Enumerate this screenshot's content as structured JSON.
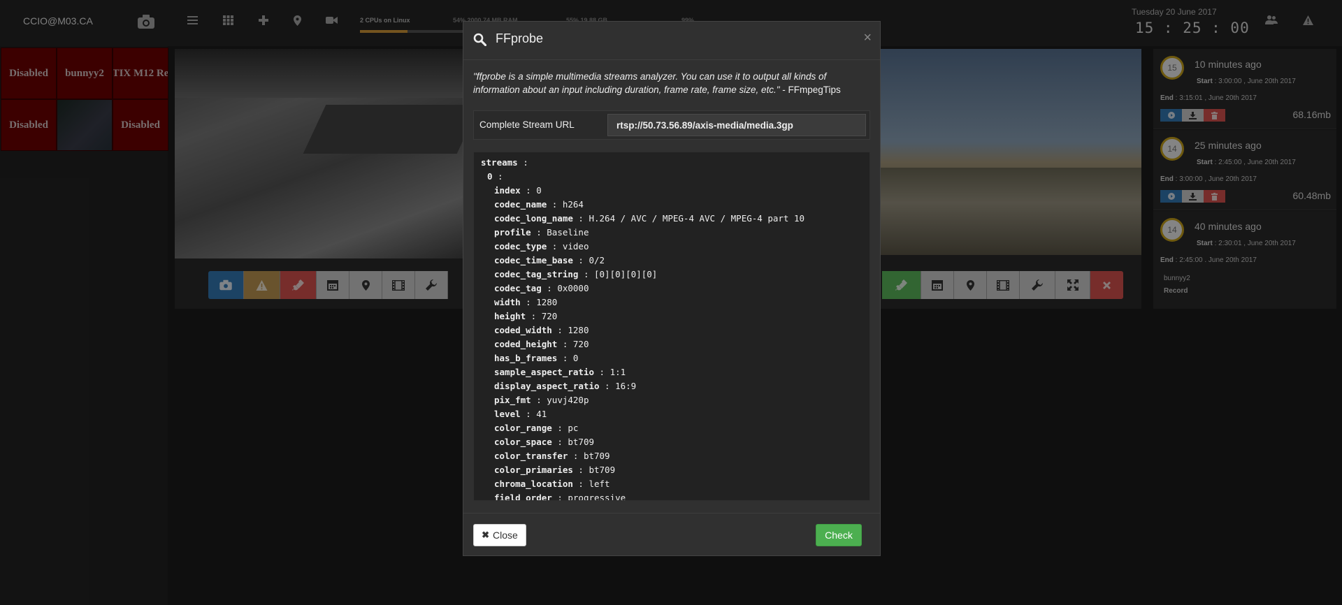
{
  "topbar": {
    "brand": "CCIO@M03.CA",
    "nav_icons": [
      "menu-icon",
      "grid-icon",
      "plus-icon",
      "map-marker-icon",
      "video-camera-icon"
    ],
    "cpu_label": "2 CPUs on Linux",
    "cpu_progress": 0.45,
    "ram_label": "54%  2000.74 MB RAM",
    "disk_label": "55%  19.88 GB",
    "net_label": "99%",
    "date": "Tuesday 20 June 2017",
    "time": "15 : 25 : 00",
    "right_icons": [
      "users-icon",
      "warning-icon"
    ]
  },
  "monitors": [
    {
      "label": "Disabled"
    },
    {
      "label": "bunnyy2"
    },
    {
      "label": "TIX M12 Re"
    },
    {
      "label": "Disabled"
    },
    {
      "label": ""
    },
    {
      "label": "Disabled"
    }
  ],
  "recordings": [
    {
      "count": "15",
      "ago": "10 minutes ago",
      "start_label": "Start",
      "start": ": 3:00:00 , June 20th 2017",
      "end_label": "End",
      "end": ": 3:15:01 , June 20th 2017",
      "size": "68.16mb"
    },
    {
      "count": "14",
      "ago": "25 minutes ago",
      "start_label": "Start",
      "start": ": 2:45:00 , June 20th 2017",
      "end_label": "End",
      "end": ": 3:00:00 , June 20th 2017",
      "size": "60.48mb"
    },
    {
      "count": "14",
      "ago": "40 minutes ago",
      "start_label": "Start",
      "start": ": 2:30:01 , June 20th 2017",
      "end_label": "End",
      "end": ": 2:45:00 , June 20th 2017",
      "size": ""
    }
  ],
  "rcol_footer": {
    "monitor": "bunnyy2",
    "mode": "Record"
  },
  "colors": {
    "accent_blue": "#337ab7",
    "warning": "#c09853",
    "danger": "#d9534f",
    "success": "#5cb85c"
  },
  "modal": {
    "title": "FFprobe",
    "quote_italic": "\"ffprobe is a simple multimedia streams analyzer. You can use it to output all kinds of information about an input including duration, frame rate, frame size, etc.\"",
    "quote_source": " - FFmpegTips",
    "url_label": "Complete Stream URL",
    "url_value": "rtsp://50.73.56.89/axis-media/media.3gp",
    "close_label": "Close",
    "check_label": "Check",
    "output": [
      {
        "indent": 0,
        "key": "streams",
        "value": ""
      },
      {
        "indent": 1,
        "key": "0",
        "value": ""
      },
      {
        "indent": 2,
        "key": "index",
        "value": "0"
      },
      {
        "indent": 2,
        "key": "codec_name",
        "value": "h264"
      },
      {
        "indent": 2,
        "key": "codec_long_name",
        "value": "H.264 / AVC / MPEG-4 AVC / MPEG-4 part 10"
      },
      {
        "indent": 2,
        "key": "profile",
        "value": "Baseline"
      },
      {
        "indent": 2,
        "key": "codec_type",
        "value": "video"
      },
      {
        "indent": 2,
        "key": "codec_time_base",
        "value": "0/2"
      },
      {
        "indent": 2,
        "key": "codec_tag_string",
        "value": "[0][0][0][0]"
      },
      {
        "indent": 2,
        "key": "codec_tag",
        "value": "0x0000"
      },
      {
        "indent": 2,
        "key": "width",
        "value": "1280"
      },
      {
        "indent": 2,
        "key": "height",
        "value": "720"
      },
      {
        "indent": 2,
        "key": "coded_width",
        "value": "1280"
      },
      {
        "indent": 2,
        "key": "coded_height",
        "value": "720"
      },
      {
        "indent": 2,
        "key": "has_b_frames",
        "value": "0"
      },
      {
        "indent": 2,
        "key": "sample_aspect_ratio",
        "value": "1:1"
      },
      {
        "indent": 2,
        "key": "display_aspect_ratio",
        "value": "16:9"
      },
      {
        "indent": 2,
        "key": "pix_fmt",
        "value": "yuvj420p"
      },
      {
        "indent": 2,
        "key": "level",
        "value": "41"
      },
      {
        "indent": 2,
        "key": "color_range",
        "value": "pc"
      },
      {
        "indent": 2,
        "key": "color_space",
        "value": "bt709"
      },
      {
        "indent": 2,
        "key": "color_transfer",
        "value": "bt709"
      },
      {
        "indent": 2,
        "key": "color_primaries",
        "value": "bt709"
      },
      {
        "indent": 2,
        "key": "chroma_location",
        "value": "left"
      },
      {
        "indent": 2,
        "key": "field_order",
        "value": "progressive"
      }
    ]
  }
}
